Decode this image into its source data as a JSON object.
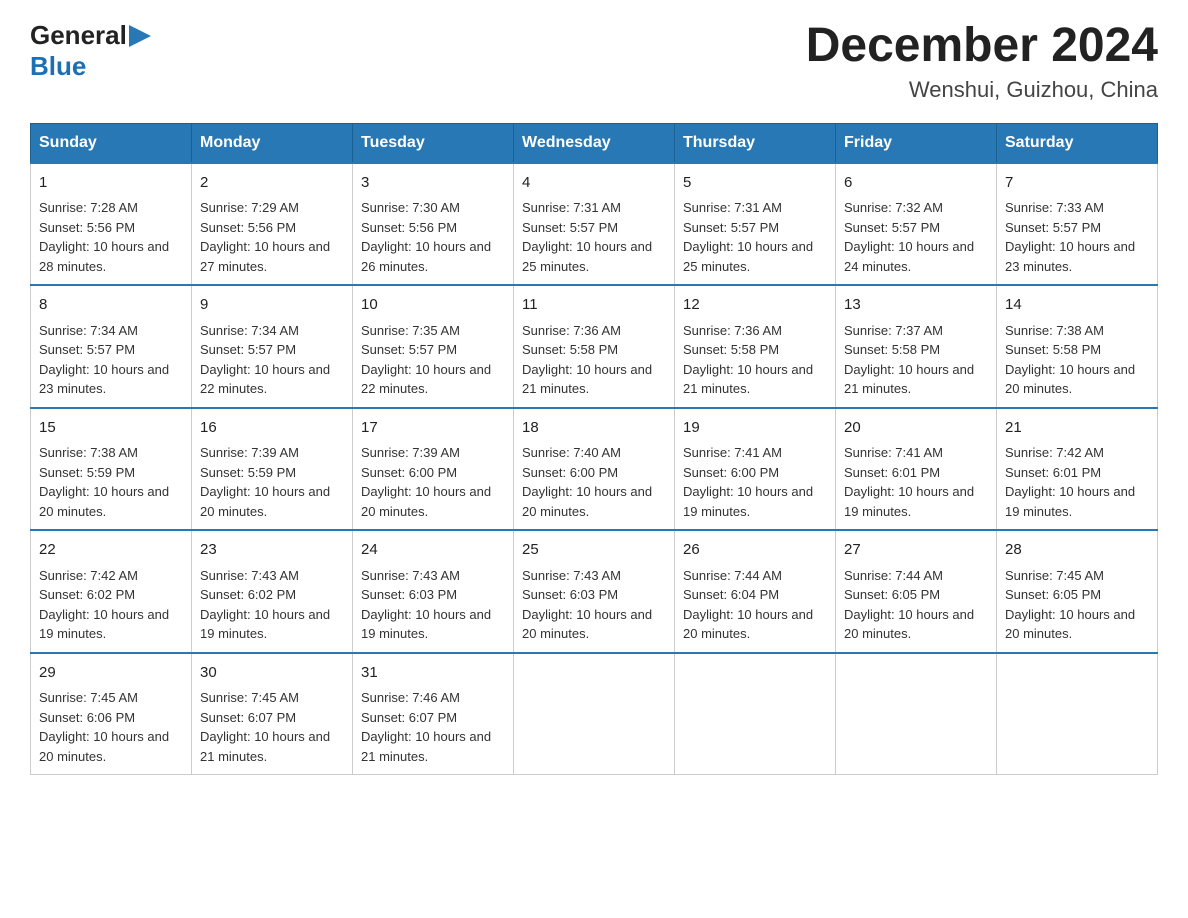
{
  "header": {
    "logo_general": "General",
    "logo_blue": "Blue",
    "month_title": "December 2024",
    "location": "Wenshui, Guizhou, China"
  },
  "days_of_week": [
    "Sunday",
    "Monday",
    "Tuesday",
    "Wednesday",
    "Thursday",
    "Friday",
    "Saturday"
  ],
  "weeks": [
    [
      {
        "day": "1",
        "sunrise": "7:28 AM",
        "sunset": "5:56 PM",
        "daylight": "10 hours and 28 minutes."
      },
      {
        "day": "2",
        "sunrise": "7:29 AM",
        "sunset": "5:56 PM",
        "daylight": "10 hours and 27 minutes."
      },
      {
        "day": "3",
        "sunrise": "7:30 AM",
        "sunset": "5:56 PM",
        "daylight": "10 hours and 26 minutes."
      },
      {
        "day": "4",
        "sunrise": "7:31 AM",
        "sunset": "5:57 PM",
        "daylight": "10 hours and 25 minutes."
      },
      {
        "day": "5",
        "sunrise": "7:31 AM",
        "sunset": "5:57 PM",
        "daylight": "10 hours and 25 minutes."
      },
      {
        "day": "6",
        "sunrise": "7:32 AM",
        "sunset": "5:57 PM",
        "daylight": "10 hours and 24 minutes."
      },
      {
        "day": "7",
        "sunrise": "7:33 AM",
        "sunset": "5:57 PM",
        "daylight": "10 hours and 23 minutes."
      }
    ],
    [
      {
        "day": "8",
        "sunrise": "7:34 AM",
        "sunset": "5:57 PM",
        "daylight": "10 hours and 23 minutes."
      },
      {
        "day": "9",
        "sunrise": "7:34 AM",
        "sunset": "5:57 PM",
        "daylight": "10 hours and 22 minutes."
      },
      {
        "day": "10",
        "sunrise": "7:35 AM",
        "sunset": "5:57 PM",
        "daylight": "10 hours and 22 minutes."
      },
      {
        "day": "11",
        "sunrise": "7:36 AM",
        "sunset": "5:58 PM",
        "daylight": "10 hours and 21 minutes."
      },
      {
        "day": "12",
        "sunrise": "7:36 AM",
        "sunset": "5:58 PM",
        "daylight": "10 hours and 21 minutes."
      },
      {
        "day": "13",
        "sunrise": "7:37 AM",
        "sunset": "5:58 PM",
        "daylight": "10 hours and 21 minutes."
      },
      {
        "day": "14",
        "sunrise": "7:38 AM",
        "sunset": "5:58 PM",
        "daylight": "10 hours and 20 minutes."
      }
    ],
    [
      {
        "day": "15",
        "sunrise": "7:38 AM",
        "sunset": "5:59 PM",
        "daylight": "10 hours and 20 minutes."
      },
      {
        "day": "16",
        "sunrise": "7:39 AM",
        "sunset": "5:59 PM",
        "daylight": "10 hours and 20 minutes."
      },
      {
        "day": "17",
        "sunrise": "7:39 AM",
        "sunset": "6:00 PM",
        "daylight": "10 hours and 20 minutes."
      },
      {
        "day": "18",
        "sunrise": "7:40 AM",
        "sunset": "6:00 PM",
        "daylight": "10 hours and 20 minutes."
      },
      {
        "day": "19",
        "sunrise": "7:41 AM",
        "sunset": "6:00 PM",
        "daylight": "10 hours and 19 minutes."
      },
      {
        "day": "20",
        "sunrise": "7:41 AM",
        "sunset": "6:01 PM",
        "daylight": "10 hours and 19 minutes."
      },
      {
        "day": "21",
        "sunrise": "7:42 AM",
        "sunset": "6:01 PM",
        "daylight": "10 hours and 19 minutes."
      }
    ],
    [
      {
        "day": "22",
        "sunrise": "7:42 AM",
        "sunset": "6:02 PM",
        "daylight": "10 hours and 19 minutes."
      },
      {
        "day": "23",
        "sunrise": "7:43 AM",
        "sunset": "6:02 PM",
        "daylight": "10 hours and 19 minutes."
      },
      {
        "day": "24",
        "sunrise": "7:43 AM",
        "sunset": "6:03 PM",
        "daylight": "10 hours and 19 minutes."
      },
      {
        "day": "25",
        "sunrise": "7:43 AM",
        "sunset": "6:03 PM",
        "daylight": "10 hours and 20 minutes."
      },
      {
        "day": "26",
        "sunrise": "7:44 AM",
        "sunset": "6:04 PM",
        "daylight": "10 hours and 20 minutes."
      },
      {
        "day": "27",
        "sunrise": "7:44 AM",
        "sunset": "6:05 PM",
        "daylight": "10 hours and 20 minutes."
      },
      {
        "day": "28",
        "sunrise": "7:45 AM",
        "sunset": "6:05 PM",
        "daylight": "10 hours and 20 minutes."
      }
    ],
    [
      {
        "day": "29",
        "sunrise": "7:45 AM",
        "sunset": "6:06 PM",
        "daylight": "10 hours and 20 minutes."
      },
      {
        "day": "30",
        "sunrise": "7:45 AM",
        "sunset": "6:07 PM",
        "daylight": "10 hours and 21 minutes."
      },
      {
        "day": "31",
        "sunrise": "7:46 AM",
        "sunset": "6:07 PM",
        "daylight": "10 hours and 21 minutes."
      },
      null,
      null,
      null,
      null
    ]
  ],
  "labels": {
    "sunrise": "Sunrise:",
    "sunset": "Sunset:",
    "daylight": "Daylight:"
  }
}
